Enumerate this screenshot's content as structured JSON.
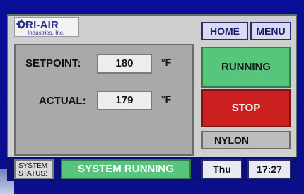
{
  "logo": {
    "brand": "DRI-AIR",
    "subtitle": "Industries, Inc."
  },
  "top_nav": {
    "home_label": "HOME",
    "menu_label": "MENU"
  },
  "temperature": {
    "setpoint_label": "SETPOINT:",
    "setpoint_value": "180",
    "setpoint_unit": "°F",
    "actual_label": "ACTUAL:",
    "actual_value": "179",
    "actual_unit": "°F"
  },
  "controls": {
    "running_label": "RUNNING",
    "stop_label": "STOP",
    "material": "NYLON"
  },
  "status": {
    "label_line1": "SYSTEM",
    "label_line2": "STATUS:",
    "value": "SYSTEM RUNNING"
  },
  "clock": {
    "day": "Thu",
    "time": "17:27"
  },
  "colors": {
    "running_green": "#57c57c",
    "stop_red": "#cc1f1f",
    "screen_blue": "#0a0f99",
    "panel_gray": "#cfcfcf"
  }
}
